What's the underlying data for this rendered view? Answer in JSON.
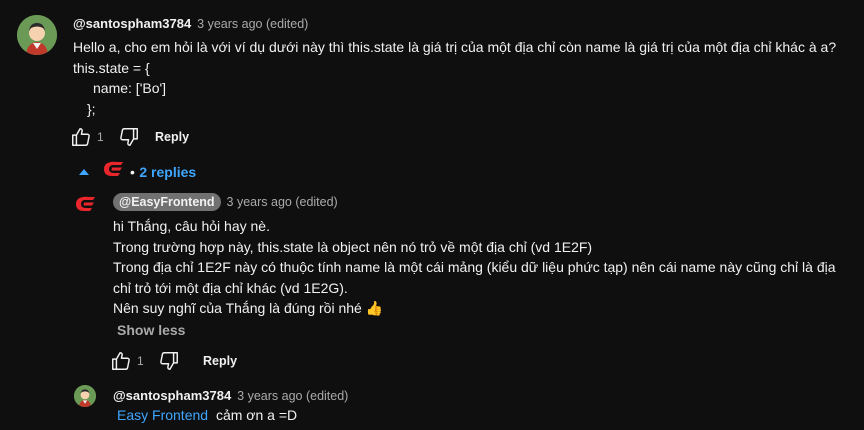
{
  "comment": {
    "author": "@santospham3784",
    "meta": "3 years ago (edited)",
    "lines": [
      "Hello a, cho em hỏi là với ví dụ dưới này thì this.state là giá trị của một địa chỉ còn name là giá trị của một địa chỉ khác à a?",
      "this.state = {",
      "name: ['Bo']",
      "};"
    ],
    "like_count": "1",
    "reply_label": "Reply",
    "replies_toggle": "2 replies"
  },
  "reply1": {
    "author": "@EasyFrontend",
    "meta": "3 years ago (edited)",
    "lines": [
      "hi Thắng, câu hỏi hay nè.",
      "Trong trường hợp này, this.state là object nên nó trỏ về một địa chỉ (vd 1E2F)",
      "Trong địa chỉ 1E2F này có thuộc tính name là một cái mảng (kiểu dữ liệu phức tạp) nên cái name này cũng chỉ là địa",
      "chỉ trỏ tới một địa chỉ khác (vd 1E2G).",
      "Nên suy nghĩ của Thắng là đúng rồi nhé"
    ],
    "emoji": "👍",
    "show_less": "Show less",
    "like_count": "1",
    "reply_label": "Reply"
  },
  "reply2": {
    "author": "@santospham3784",
    "meta": "3 years ago (edited)",
    "mention": "Easy Frontend",
    "text": "cảm ơn a =D"
  },
  "colors": {
    "background": "#0f0f0f",
    "link": "#3ea6ff",
    "brand": "#e8262b"
  }
}
